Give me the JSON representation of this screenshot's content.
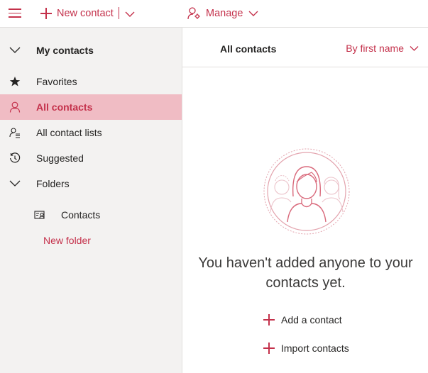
{
  "toolbar": {
    "menu_icon": "hamburger-icon",
    "new_contact_label": "New contact",
    "manage_label": "Manage",
    "accent": "#c4314b"
  },
  "sidebar": {
    "my_contacts": "My contacts",
    "items": [
      {
        "label": "Favorites",
        "icon": "star-icon"
      },
      {
        "label": "All contacts",
        "icon": "person-icon",
        "active": true
      },
      {
        "label": "All contact lists",
        "icon": "contact-list-icon"
      },
      {
        "label": "Suggested",
        "icon": "history-icon"
      }
    ],
    "folders_label": "Folders",
    "folders": [
      {
        "label": "Contacts",
        "icon": "contact-card-icon"
      }
    ],
    "new_folder_label": "New folder",
    "active_bg": "#f0bcc4"
  },
  "main": {
    "title": "All contacts",
    "sort_label": "By first name",
    "empty_message": "You haven't added anyone to your contacts yet.",
    "actions": [
      {
        "label": "Add a contact"
      },
      {
        "label": "Import contacts"
      }
    ]
  }
}
